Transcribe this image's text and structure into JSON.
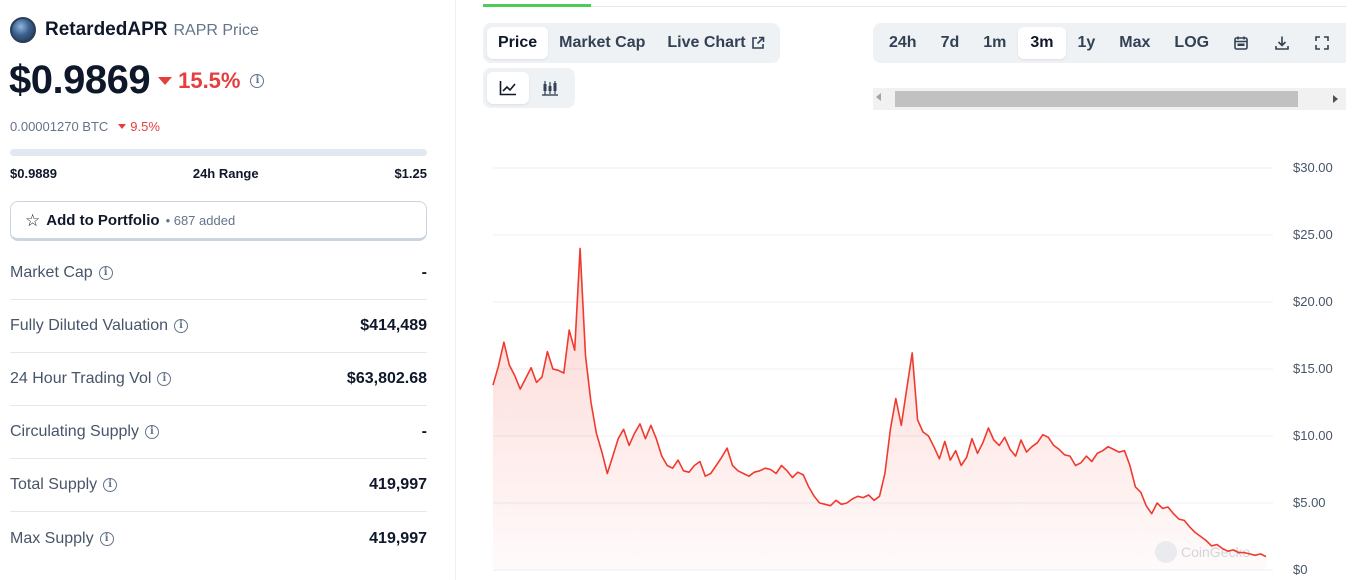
{
  "coin": {
    "name": "RetardedAPR",
    "symbol_label": "RAPR Price",
    "price": "$0.9869",
    "change_24h": "15.5%",
    "btc_price": "0.00001270 BTC",
    "btc_change": "9.5%",
    "range_low": "$0.9889",
    "range_label": "24h Range",
    "range_high": "$1.25",
    "info_glyph": "i"
  },
  "portfolio": {
    "label": "Add to Portfolio",
    "count": "• 687 added"
  },
  "stats": [
    {
      "label": "Market Cap",
      "value": "-"
    },
    {
      "label": "Fully Diluted Valuation",
      "value": "$414,489"
    },
    {
      "label": "24 Hour Trading Vol",
      "value": "$63,802.68"
    },
    {
      "label": "Circulating Supply",
      "value": "-"
    },
    {
      "label": "Total Supply",
      "value": "419,997"
    },
    {
      "label": "Max Supply",
      "value": "419,997"
    }
  ],
  "tabs": {
    "price": "Price",
    "market_cap": "Market Cap",
    "live_chart": "Live Chart"
  },
  "ranges": {
    "r24h": "24h",
    "r7d": "7d",
    "r1m": "1m",
    "r3m": "3m",
    "r1y": "1y",
    "max": "Max",
    "log": "LOG",
    "selected": "3m"
  },
  "colors": {
    "down": "#e53e3e",
    "line": "#f03a2e",
    "accent_green": "#4bcc5a"
  },
  "icons": {
    "calendar": "calendar-icon",
    "download": "download-icon",
    "line_chart": "line-chart-icon",
    "candlestick": "candlestick-chart-icon",
    "external": "external-link-icon",
    "star": "star-icon"
  },
  "chart_data": {
    "type": "area",
    "title": "",
    "xlabel": "",
    "ylabel": "",
    "ylim": [
      0,
      30
    ],
    "yticks": [
      0,
      5,
      10,
      15,
      20,
      25,
      30
    ],
    "ytick_labels": [
      "$0",
      "$5.00",
      "$10.00",
      "$15.00",
      "$20.00",
      "$25.00",
      "$30.00"
    ],
    "watermark": "CoinGecko",
    "grid": true,
    "series": [
      {
        "values": [
          13.8,
          15.2,
          17.0,
          15.3,
          14.5,
          13.5,
          14.3,
          15.1,
          14.0,
          14.4,
          16.3,
          15.0,
          14.9,
          14.7,
          17.9,
          16.4,
          24.0,
          16.0,
          12.5,
          10.2,
          8.8,
          7.2,
          8.5,
          9.8,
          10.5,
          9.3,
          10.2,
          10.9,
          9.8,
          10.8,
          9.8,
          8.5,
          7.8,
          7.6,
          8.2,
          7.4,
          7.3,
          7.8,
          8.1,
          7.0,
          7.2,
          7.8,
          8.4,
          9.1,
          7.8,
          7.4,
          7.2,
          7.0,
          7.3,
          7.4,
          7.6,
          7.5,
          7.2,
          7.8,
          7.4,
          6.9,
          7.3,
          7.1,
          6.2,
          5.5,
          5.0,
          4.9,
          4.8,
          5.2,
          4.9,
          5.0,
          5.3,
          5.5,
          5.4,
          5.6,
          5.2,
          5.5,
          7.2,
          10.5,
          12.8,
          10.8,
          13.5,
          16.2,
          11.2,
          10.3,
          10.0,
          9.2,
          8.3,
          9.6,
          8.2,
          8.9,
          7.8,
          8.4,
          9.8,
          8.7,
          9.5,
          10.6,
          9.7,
          9.3,
          9.9,
          9.0,
          8.5,
          9.7,
          8.8,
          9.2,
          9.5,
          10.1,
          9.9,
          9.3,
          9.0,
          8.6,
          8.5,
          7.8,
          8.0,
          8.5,
          8.1,
          8.7,
          8.9,
          9.2,
          9.0,
          8.8,
          8.9,
          7.8,
          6.2,
          5.8,
          4.8,
          4.2,
          5.0,
          4.6,
          4.7,
          4.2,
          3.8,
          3.7,
          3.2,
          2.8,
          2.5,
          2.2,
          1.8,
          1.9,
          1.6,
          1.4,
          1.5,
          1.3,
          1.3,
          1.2,
          1.1,
          1.2,
          1.0
        ]
      }
    ]
  }
}
